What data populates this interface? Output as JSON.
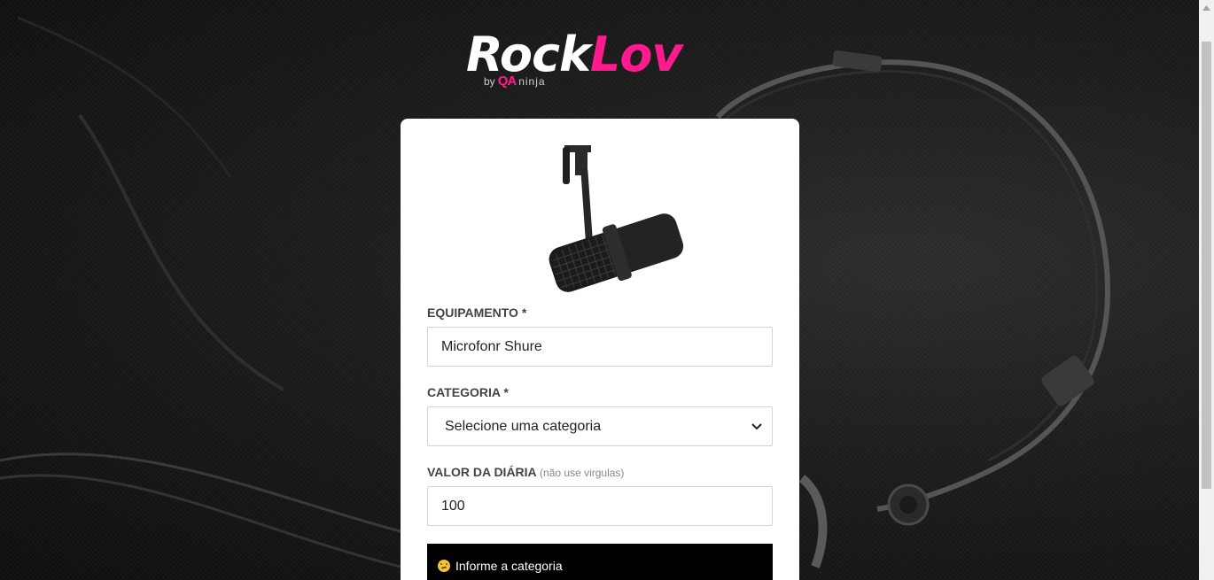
{
  "brand": {
    "name_part1": "Rock",
    "name_part2": "Lov",
    "by": "by",
    "qa": "QA",
    "ninja": "ninja",
    "accent_color": "#ff1b8d"
  },
  "form": {
    "image_icon": "microphone-image",
    "equipamento": {
      "label": "EQUIPAMENTO *",
      "value": "Microfonr Shure"
    },
    "categoria": {
      "label": "CATEGORIA *",
      "selected": "Selecione uma categoria"
    },
    "valor": {
      "label": "VALOR DA DIÁRIA",
      "hint": "(não use virgulas)",
      "value": "100"
    },
    "toast": {
      "icon": "smirk-emoji-icon",
      "message": "Informe a categoria"
    }
  }
}
